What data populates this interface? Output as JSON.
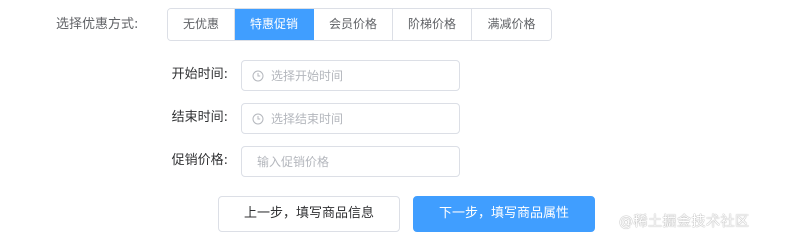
{
  "discount": {
    "label": "选择优惠方式:",
    "options": [
      "无优惠",
      "特惠促销",
      "会员价格",
      "阶梯价格",
      "满减价格"
    ],
    "selected_index": 1
  },
  "form": {
    "start_time": {
      "label": "开始时间:",
      "placeholder": "选择开始时间",
      "icon": "clock-icon"
    },
    "end_time": {
      "label": "结束时间:",
      "placeholder": "选择结束时间",
      "icon": "clock-icon"
    },
    "promo_price": {
      "label": "促销价格:",
      "placeholder": "输入促销价格"
    }
  },
  "actions": {
    "prev_label": "上一步，填写商品信息",
    "next_label": "下一步，填写商品属性"
  },
  "watermark": "@稀土掘金技术社区",
  "colors": {
    "primary": "#409eff",
    "border": "#dcdfe6",
    "placeholder": "#b4b7bd"
  }
}
